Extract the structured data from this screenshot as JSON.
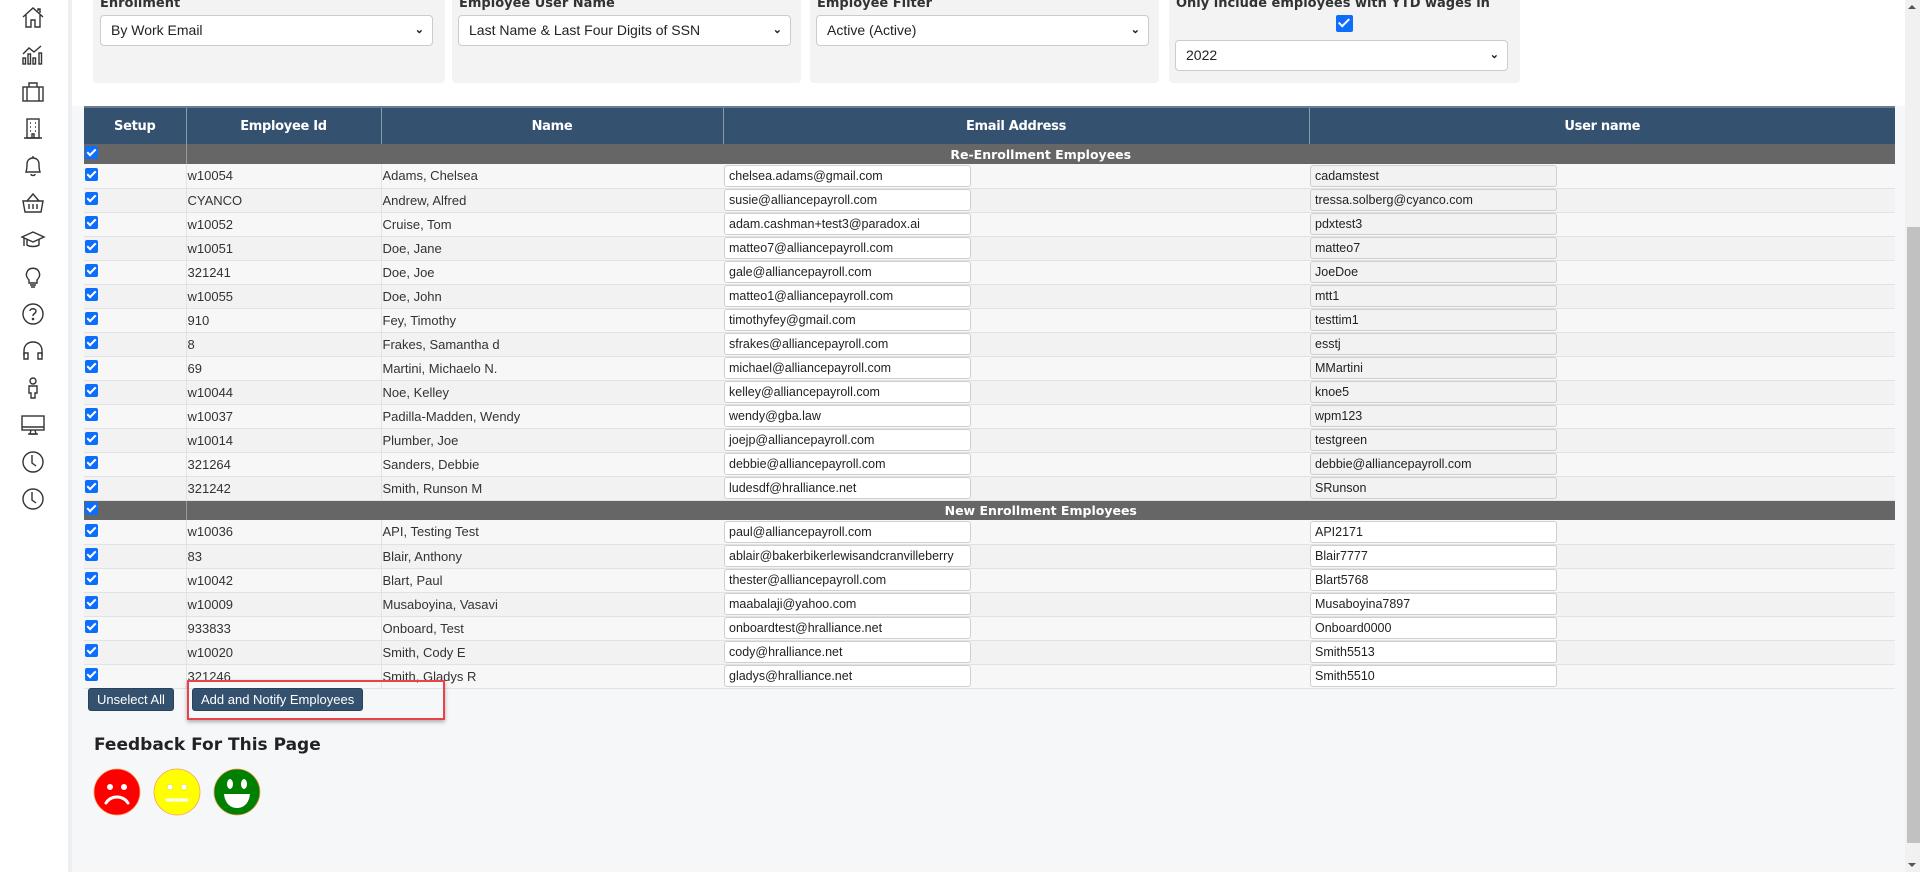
{
  "sidebar": {
    "icons": [
      "home-icon",
      "analytics-icon",
      "briefcase-icon",
      "building-icon",
      "bell-icon",
      "basket-icon",
      "graduation-cap-icon",
      "lightbulb-icon",
      "help-icon",
      "headset-icon",
      "person-icon",
      "monitor-icon",
      "clock-icon",
      "clock-icon"
    ]
  },
  "filters": {
    "enrollment": {
      "label": "Enrollment",
      "value": "By Work Email"
    },
    "user_name": {
      "label": "Employee User Name",
      "value": "Last Name & Last Four Digits of SSN"
    },
    "employee_filter": {
      "label": "Employee Filter",
      "value": "Active (Active)"
    },
    "ytd_wages": {
      "label": "Only include employees with YTD wages in",
      "checked": true,
      "year": "2022"
    }
  },
  "table": {
    "columns": [
      "Setup",
      "Employee Id",
      "Name",
      "Email Address",
      "User name"
    ],
    "groups": [
      {
        "title": "Re-Enrollment Employees",
        "checked": true,
        "rows": [
          {
            "id": "w10054",
            "name": "Adams, Chelsea",
            "email": "chelsea.adams@gmail.com",
            "username": "cadamstest",
            "checked": true
          },
          {
            "id": "CYANCO",
            "name": "Andrew, Alfred",
            "email": "susie@alliancepayroll.com",
            "username": "tressa.solberg@cyanco.com",
            "checked": true
          },
          {
            "id": "w10052",
            "name": "Cruise, Tom",
            "email": "adam.cashman+test3@paradox.ai",
            "username": "pdxtest3",
            "checked": true
          },
          {
            "id": "w10051",
            "name": "Doe, Jane",
            "email": "matteo7@alliancepayroll.com",
            "username": "matteo7",
            "checked": true
          },
          {
            "id": "321241",
            "name": "Doe, Joe",
            "email": "gale@alliancepayroll.com",
            "username": "JoeDoe",
            "checked": true
          },
          {
            "id": "w10055",
            "name": "Doe, John",
            "email": "matteo1@alliancepayroll.com",
            "username": "mtt1",
            "checked": true
          },
          {
            "id": "910",
            "name": "Fey, Timothy",
            "email": "timothyfey@gmail.com",
            "username": "testtim1",
            "checked": true
          },
          {
            "id": "8",
            "name": "Frakes, Samantha d",
            "email": "sfrakes@alliancepayroll.com",
            "username": "esstj",
            "checked": true
          },
          {
            "id": "69",
            "name": "Martini, Michaelo N.",
            "email": "michael@alliancepayroll.com",
            "username": "MMartini",
            "checked": true
          },
          {
            "id": "w10044",
            "name": "Noe, Kelley",
            "email": "kelley@alliancepayroll.com",
            "username": "knoe5",
            "checked": true
          },
          {
            "id": "w10037",
            "name": "Padilla-Madden, Wendy",
            "email": "wendy@gba.law",
            "username": "wpm123",
            "checked": true
          },
          {
            "id": "w10014",
            "name": "Plumber, Joe",
            "email": "joejp@alliancepayroll.com",
            "username": "testgreen",
            "checked": true
          },
          {
            "id": "321264",
            "name": "Sanders, Debbie",
            "email": "debbie@alliancepayroll.com",
            "username": "debbie@alliancepayroll.com",
            "checked": true
          },
          {
            "id": "321242",
            "name": "Smith, Runson M",
            "email": "ludesdf@hralliance.net",
            "username": "SRunson",
            "checked": true
          }
        ]
      },
      {
        "title": "New Enrollment Employees",
        "checked": true,
        "rows": [
          {
            "id": "w10036",
            "name": "API, Testing Test",
            "email": "paul@alliancepayroll.com",
            "username": "API2171",
            "checked": true
          },
          {
            "id": "83",
            "name": "Blair, Anthony",
            "email": "ablair@bakerbikerlewisandcranvilleberry",
            "username": "Blair7777",
            "checked": true
          },
          {
            "id": "w10042",
            "name": "Blart, Paul",
            "email": "thester@alliancepayroll.com",
            "username": "Blart5768",
            "checked": true
          },
          {
            "id": "w10009",
            "name": "Musaboyina, Vasavi",
            "email": "maabalaji@yahoo.com",
            "username": "Musaboyina7897",
            "checked": true
          },
          {
            "id": "933833",
            "name": "Onboard, Test",
            "email": "onboardtest@hralliance.net",
            "username": "Onboard0000",
            "checked": true
          },
          {
            "id": "w10020",
            "name": "Smith, Cody E",
            "email": "cody@hralliance.net",
            "username": "Smith5513",
            "checked": true
          },
          {
            "id": "321246",
            "name": "Smith, Gladys R",
            "email": "gladys@hralliance.net",
            "username": "Smith5510",
            "checked": true
          }
        ]
      }
    ]
  },
  "actions": {
    "unselect_all": "Unselect All",
    "add_notify": "Add and Notify Employees"
  },
  "feedback": {
    "title": "Feedback For This Page",
    "options": [
      {
        "name": "sad",
        "color": "#ff0000"
      },
      {
        "name": "neutral",
        "color": "#ffff00"
      },
      {
        "name": "happy",
        "color": "#008000"
      }
    ]
  }
}
